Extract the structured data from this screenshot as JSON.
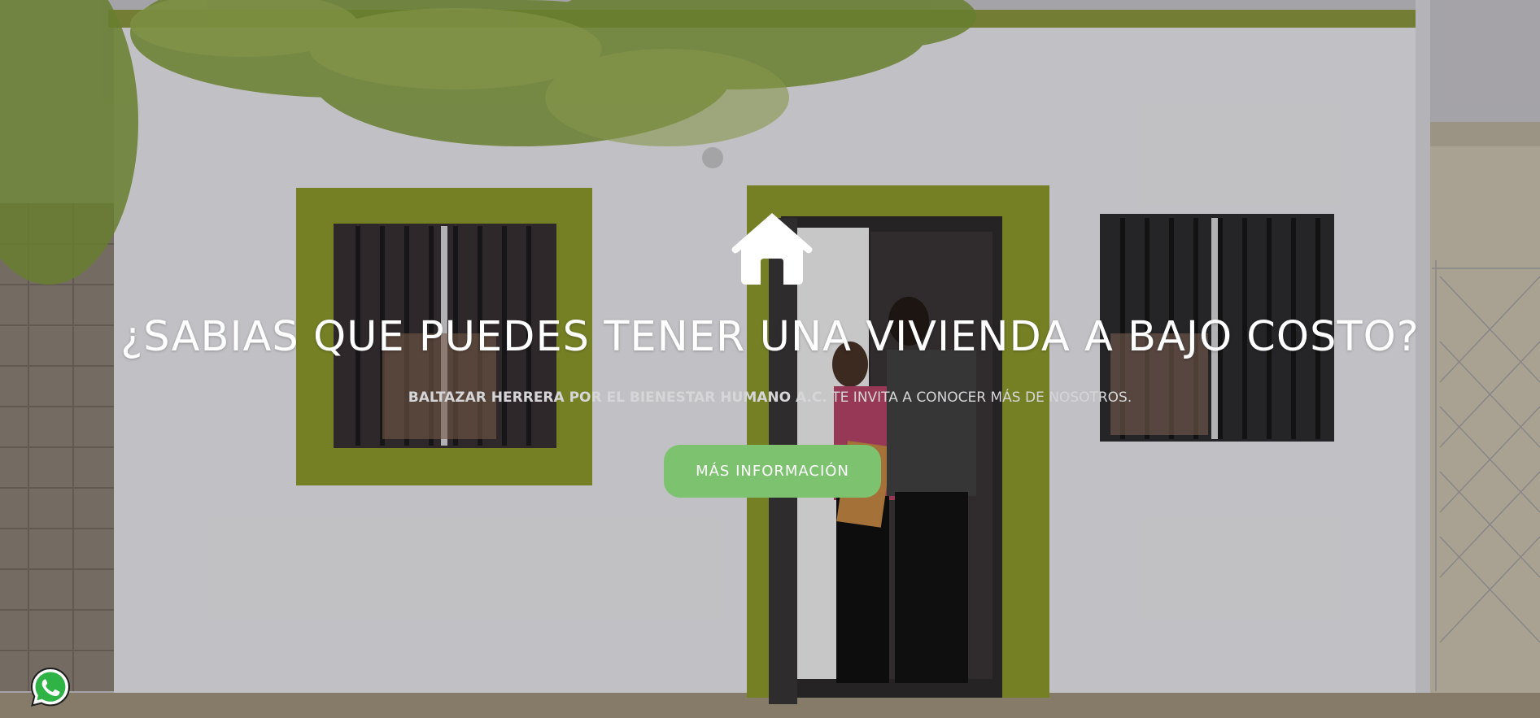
{
  "hero": {
    "headline": "¿SABIAS QUE PUEDES TENER UNA VIVIENDA A BAJO COSTO?",
    "subline_org": "BALTAZAR HERRERA POR EL BIENESTAR HUMANO A.C.",
    "subline_rest": " TE INVITA A CONOCER MÁS DE NOSOTROS.",
    "cta_label": "MÁS INFORMACIÓN",
    "icon": "home-icon"
  },
  "floating": {
    "icon": "whatsapp-icon"
  },
  "colors": {
    "accent_green": "#7dc36f",
    "window_frame_green": "#8f9b2c",
    "headline_text": "#ffffff",
    "subline_text": "#d6d6d8"
  }
}
